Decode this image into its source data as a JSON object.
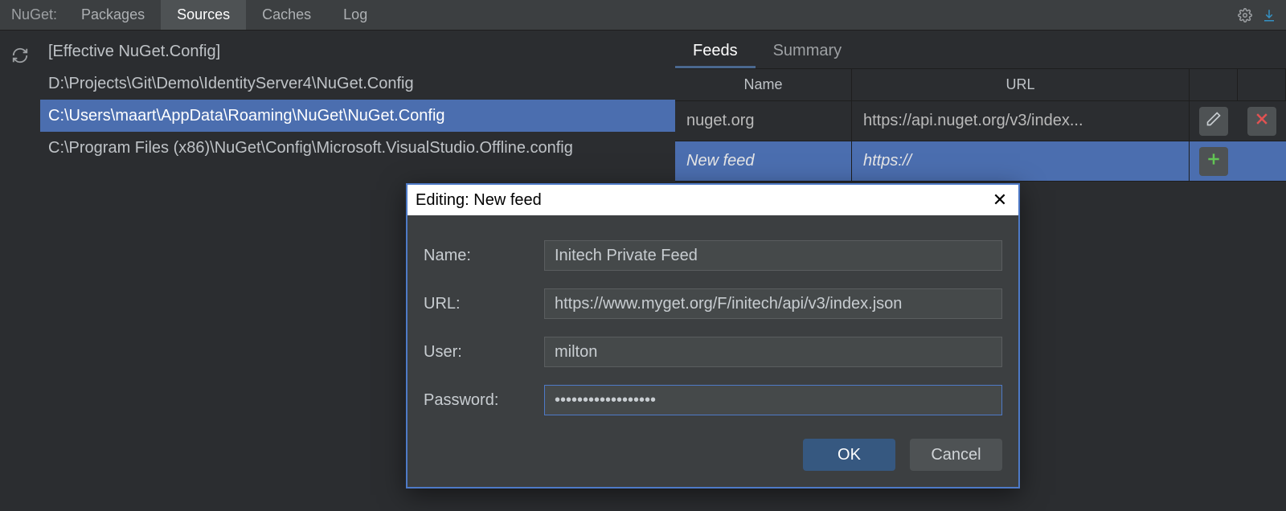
{
  "toolbar": {
    "title": "NuGet:",
    "tabs": [
      {
        "label": "Packages",
        "active": false
      },
      {
        "label": "Sources",
        "active": true
      },
      {
        "label": "Caches",
        "active": false
      },
      {
        "label": "Log",
        "active": false
      }
    ]
  },
  "config_files": [
    {
      "label": "[Effective NuGet.Config]",
      "selected": false
    },
    {
      "label": "D:\\Projects\\Git\\Demo\\IdentityServer4\\NuGet.Config",
      "selected": false
    },
    {
      "label": "C:\\Users\\maart\\AppData\\Roaming\\NuGet\\NuGet.Config",
      "selected": true
    },
    {
      "label": "C:\\Program Files (x86)\\NuGet\\Config\\Microsoft.VisualStudio.Offline.config",
      "selected": false
    }
  ],
  "right": {
    "tabs": [
      {
        "label": "Feeds",
        "active": true
      },
      {
        "label": "Summary",
        "active": false
      }
    ],
    "columns": {
      "name": "Name",
      "url": "URL"
    },
    "rows": [
      {
        "name": "nuget.org",
        "url": "https://api.nuget.org/v3/index...",
        "selected": false,
        "placeholder": false,
        "action": "edit",
        "action2": "delete"
      },
      {
        "name": "New feed",
        "url": "https://",
        "selected": true,
        "placeholder": true,
        "action": "add",
        "action2": ""
      }
    ]
  },
  "dialog": {
    "title": "Editing: New feed",
    "fields": {
      "name_label": "Name:",
      "name_value": "Initech Private Feed",
      "url_label": "URL:",
      "url_value": "https://www.myget.org/F/initech/api/v3/index.json",
      "user_label": "User:",
      "user_value": "milton",
      "pass_label": "Password:",
      "pass_value": "••••••••••••••••••"
    },
    "ok": "OK",
    "cancel": "Cancel"
  }
}
